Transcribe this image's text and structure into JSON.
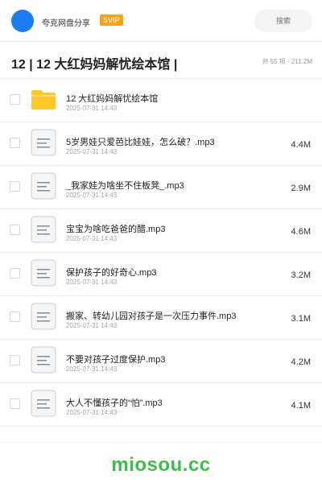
{
  "header": {
    "brand": "夸克网盘分享",
    "badge": "SVIP",
    "search_placeholder": "搜索"
  },
  "folder": {
    "title": "12 | 12 大红妈妈解忧绘本馆 |",
    "summary": "共 55 项 · 211.2M"
  },
  "files": [
    {
      "name": "12 大红妈妈解忧绘本馆",
      "date": "2025-07-31 14:43",
      "size": "",
      "type": "folder"
    },
    {
      "name": "5岁男娃只爱芭比娃娃，怎么破？.mp3",
      "date": "2025-07-31 14:43",
      "size": "4.4M",
      "type": "file"
    },
    {
      "name": "_我家娃为啥坐不住板凳_.mp3",
      "date": "2025-07-31 14:43",
      "size": "2.9M",
      "type": "file"
    },
    {
      "name": "宝宝为啥吃爸爸的醋.mp3",
      "date": "2025-07-31 14:43",
      "size": "4.6M",
      "type": "file"
    },
    {
      "name": "保护孩子的好奇心.mp3",
      "date": "2025-07-31 14:43",
      "size": "3.2M",
      "type": "file"
    },
    {
      "name": "搬家、转幼儿园对孩子是一次压力事件.mp3",
      "date": "2025-07-31 14:43",
      "size": "3.1M",
      "type": "file"
    },
    {
      "name": "不要对孩子过度保护.mp3",
      "date": "2025-07-31 14:43",
      "size": "4.2M",
      "type": "file"
    },
    {
      "name": "大人不懂孩子的“怕”.mp3",
      "date": "2025-07-31 14:43",
      "size": "4.1M",
      "type": "file"
    }
  ],
  "footer": {
    "logo": "miosou.cc"
  },
  "colors": {
    "accent": "#1e7cf2",
    "badge": "#f7a21b",
    "folder": "#ffc629",
    "logo": "#3bbf4a"
  }
}
